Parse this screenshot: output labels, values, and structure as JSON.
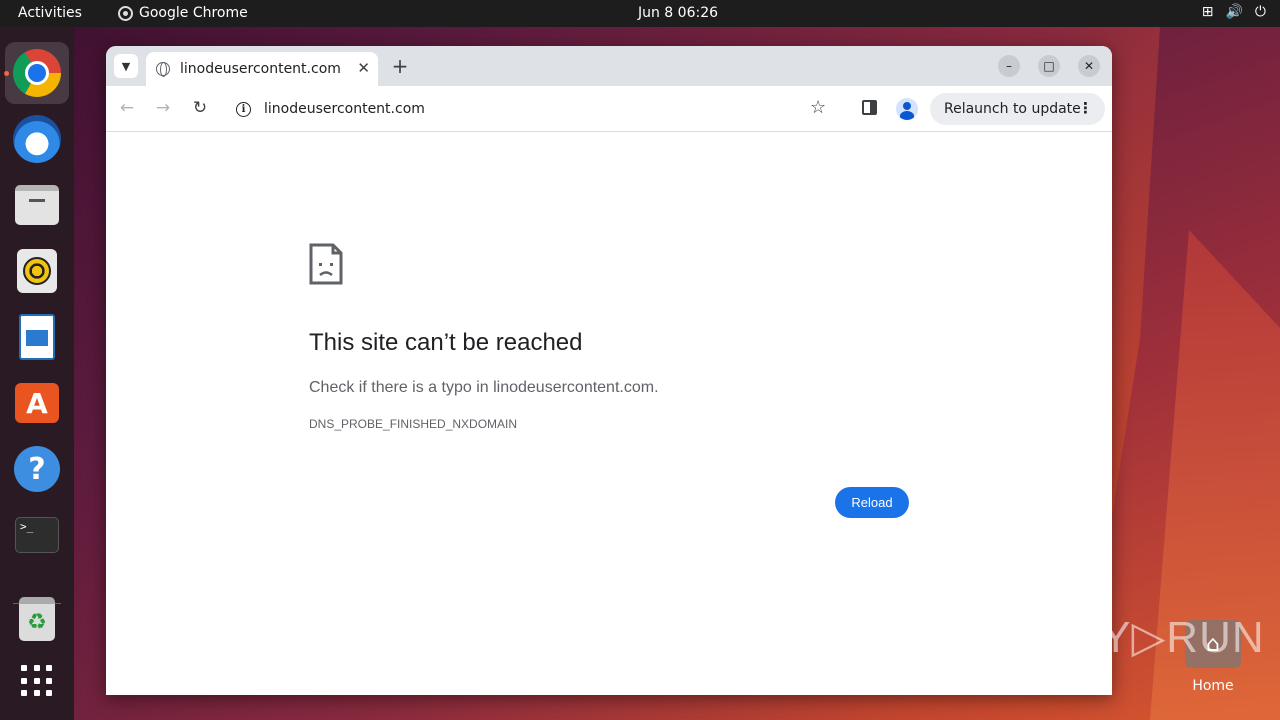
{
  "topbar": {
    "activities": "Activities",
    "app_name": "Google Chrome",
    "clock": "Jun 8  06:26",
    "tray_icons": [
      "network-icon",
      "volume-icon",
      "power-icon"
    ]
  },
  "dock": {
    "items": [
      "chrome-icon",
      "thunderbird-icon",
      "files-icon",
      "rhythmbox-icon",
      "writer-icon",
      "app-store-icon",
      "help-icon",
      "terminal-icon",
      "trash-icon",
      "show-apps-icon"
    ]
  },
  "browser": {
    "tab_title": "linodeusercontent.com",
    "address": "linodeusercontent.com",
    "relaunch_label": "Relaunch to update",
    "colors": {
      "accent": "#1a73e8",
      "tabstrip": "#dee1e6"
    }
  },
  "error_page": {
    "title": "This site can’t be reached",
    "description": "Check if there is a typo in linodeusercontent.com.",
    "code": "DNS_PROBE_FINISHED_NXDOMAIN",
    "reload_label": "Reload"
  },
  "desktop": {
    "watermark": "ANY▷RUN",
    "home_label": "Home"
  }
}
